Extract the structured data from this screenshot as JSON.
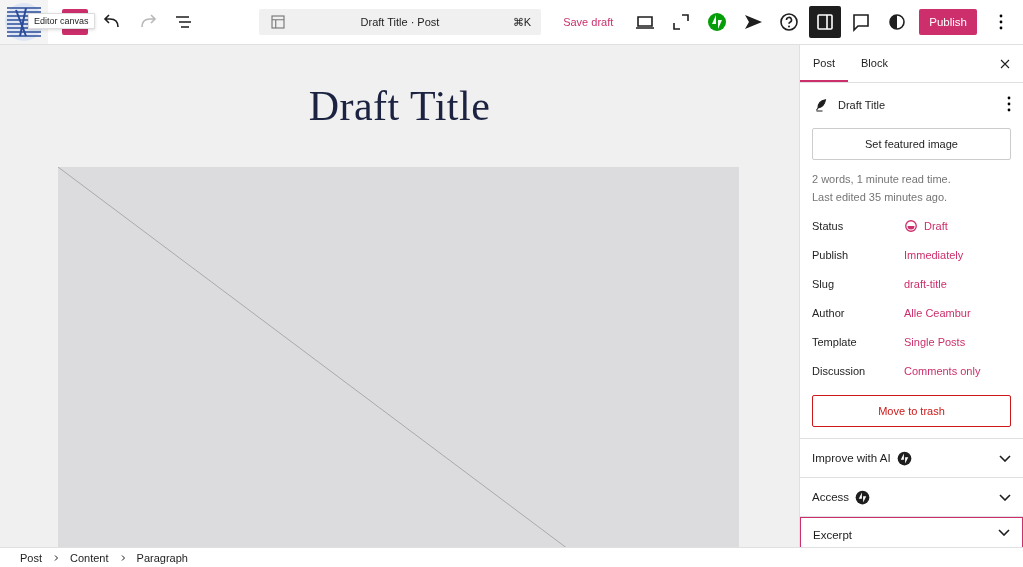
{
  "toolbar": {
    "tooltip": "Editor canvas",
    "left_buttons": [
      {
        "kind": "undo",
        "disabled": false
      },
      {
        "kind": "redo",
        "disabled": true
      },
      {
        "kind": "list-view",
        "disabled": false
      }
    ],
    "command_bar": {
      "title": "Draft Title · Post",
      "shortcut": "⌘K"
    },
    "save_draft": "Save draft",
    "right_buttons": [
      {
        "kind": "desktop",
        "selected": false
      },
      {
        "kind": "fullscreen",
        "selected": false
      },
      {
        "kind": "jetpack",
        "selected": false
      },
      {
        "kind": "send",
        "selected": false
      },
      {
        "kind": "help",
        "selected": false
      },
      {
        "kind": "settings",
        "selected": true
      },
      {
        "kind": "comments",
        "selected": false
      },
      {
        "kind": "contrast",
        "selected": false
      }
    ],
    "publish": "Publish"
  },
  "canvas": {
    "title": "Draft Title"
  },
  "sidebar": {
    "tabs": [
      {
        "label": "Post",
        "selected": true
      },
      {
        "label": "Block",
        "selected": false
      }
    ],
    "post_title": "Draft Title",
    "featured_button": "Set featured image",
    "stats": "2 words, 1 minute read time.",
    "last_edited": "Last edited 35 minutes ago.",
    "fields": [
      {
        "label": "Status",
        "value": "Draft",
        "kind": "status"
      },
      {
        "label": "Publish",
        "value": "Immediately",
        "kind": "link"
      },
      {
        "label": "Slug",
        "value": "draft-title",
        "kind": "link"
      },
      {
        "label": "Author",
        "value": "Alle Ceambur",
        "kind": "link"
      },
      {
        "label": "Template",
        "value": "Single Posts",
        "kind": "link"
      },
      {
        "label": "Discussion",
        "value": "Comments only",
        "kind": "link"
      }
    ],
    "trash_button": "Move to trash",
    "sections": [
      {
        "title": "Improve with AI",
        "kind": "jetpack",
        "focused": false
      },
      {
        "title": "Access",
        "kind": "jetpack",
        "focused": false
      },
      {
        "title": "Excerpt",
        "kind": "plain",
        "focused": true
      }
    ]
  },
  "breadcrumb": [
    "Post",
    "Content",
    "Paragraph"
  ]
}
